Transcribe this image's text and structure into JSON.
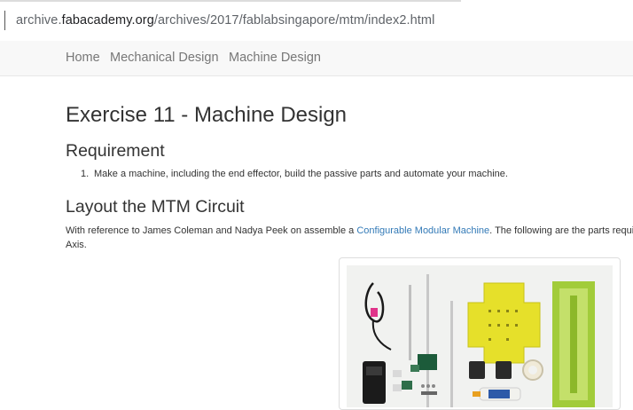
{
  "browser": {
    "url_prefix": "archive.",
    "url_host": "fabacademy.org",
    "url_path": "/archives/2017/fablabsingapore/mtm/index2.html"
  },
  "navbar": {
    "items": [
      {
        "label": "Home"
      },
      {
        "label": "Mechanical Design"
      },
      {
        "label": "Machine Design"
      }
    ]
  },
  "content": {
    "title": "Exercise 11 - Machine Design",
    "requirement_heading": "Requirement",
    "requirement_items": [
      {
        "number": "1.",
        "text": "Make a machine, including the end effector, build the passive parts and automate your machine."
      }
    ],
    "layout_heading": "Layout the MTM Circuit",
    "paragraph": {
      "before_link": "With reference to James Coleman and Nadya Peek on assemble a ",
      "link_text": "Configurable Modular Machine",
      "after_link": ". The following are the parts required",
      "line2": "Axis."
    }
  },
  "colors": {
    "link": "#337ab7",
    "navbar_bg": "#f8f8f8",
    "cardboard_yellow": "#e6e02a",
    "stage_green": "#a2cc3a"
  }
}
